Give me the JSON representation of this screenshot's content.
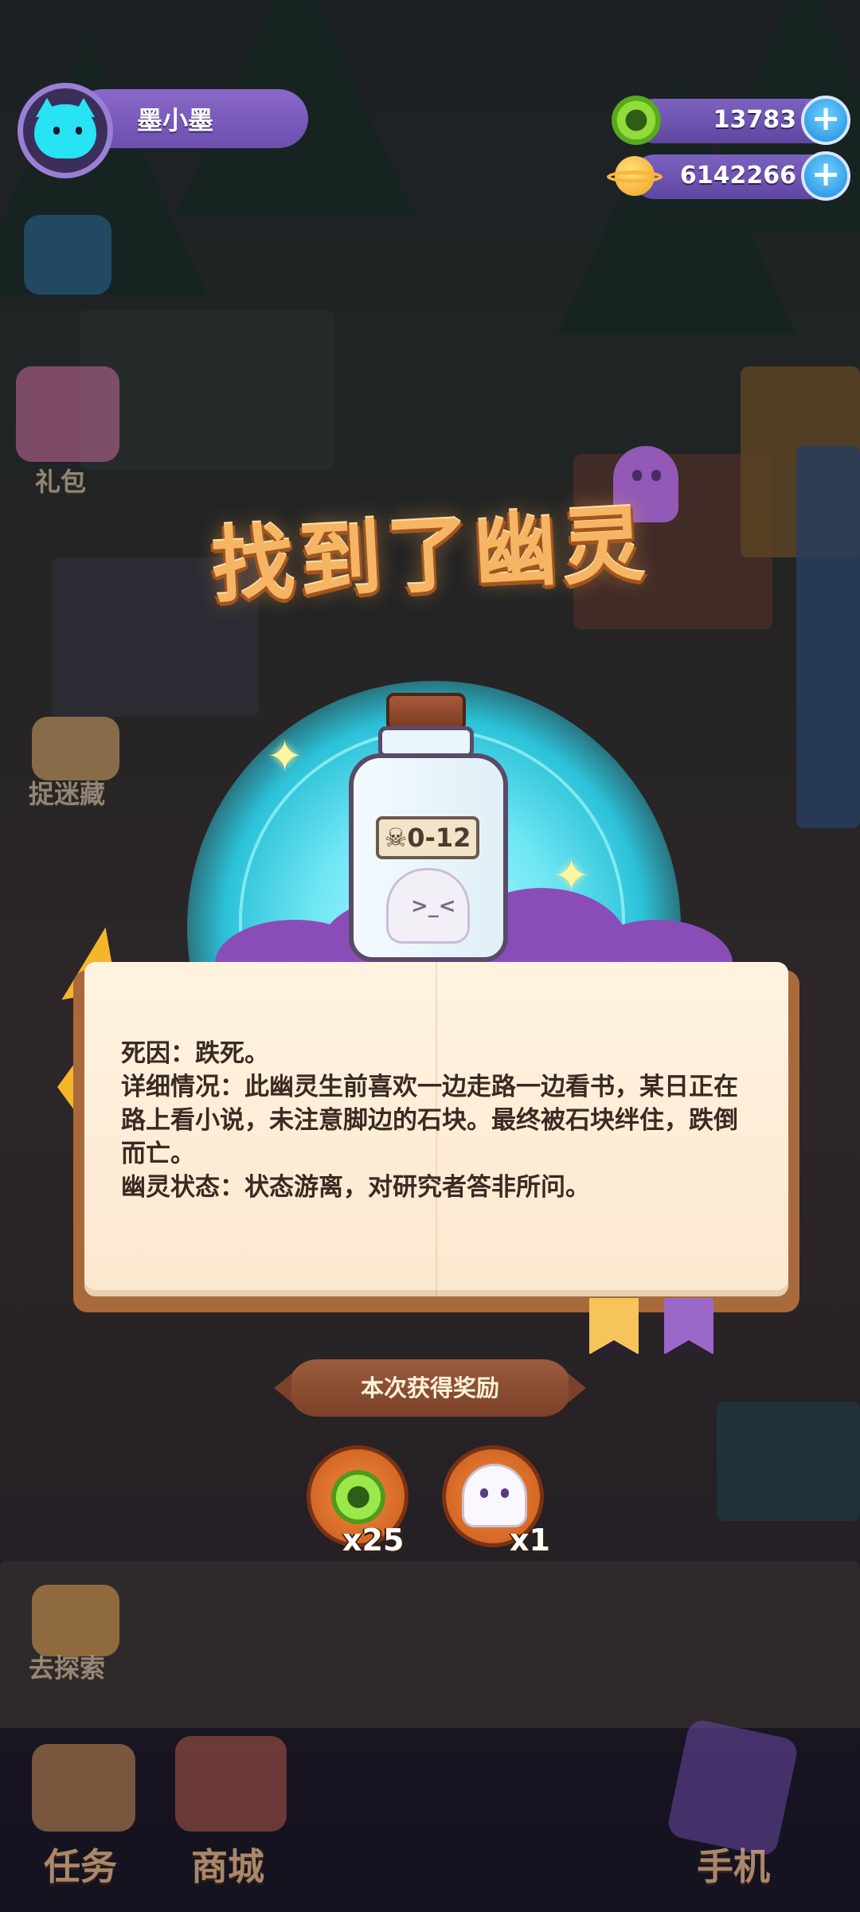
{
  "player": {
    "name": "墨小墨"
  },
  "currencies": [
    {
      "value": "13783",
      "icon": "green-donut-coin-icon",
      "plus": "+"
    },
    {
      "value": "6142266",
      "icon": "orange-planet-coin-icon",
      "plus": "+"
    }
  ],
  "side_buttons": {
    "gift": "礼包",
    "hide_seek": "捉迷藏",
    "explore": "去探索"
  },
  "popup": {
    "title": "找到了幽灵",
    "bottle_label": "☠0-12",
    "details": [
      "死因：跌死。",
      "详细情况：此幽灵生前喜欢一边走路一边看书，某日正在路上看小说，未注意脚边的石块。最终被石块绊住，跌倒而亡。",
      "幽灵状态：状态游离，对研究者答非所问。"
    ],
    "reward_title": "本次获得奖励",
    "rewards": [
      {
        "icon": "green-donut-coin-icon",
        "count": "x25"
      },
      {
        "icon": "ghost-icon",
        "count": "x1"
      }
    ]
  },
  "bottom_nav": {
    "tasks": "任务",
    "shop": "商城",
    "phone": "手机"
  },
  "colors": {
    "accent_purple": "#7c62c0",
    "glow_cyan": "#6fe6f4",
    "title_orange": "#f6b564",
    "page_cream": "#fff3e0"
  }
}
